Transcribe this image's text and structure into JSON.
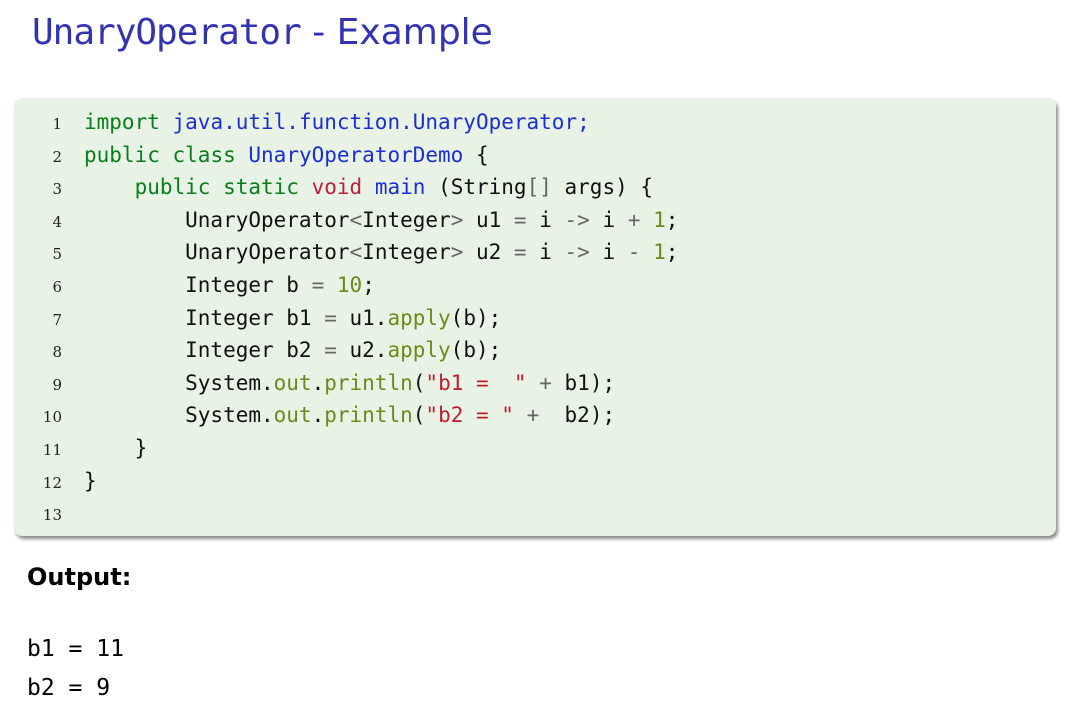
{
  "title": {
    "mono_part": "UnaryOperator",
    "sans_part": " - Example"
  },
  "code_lines": [
    {
      "no": "1",
      "text": "import java.util.function.UnaryOperator;"
    },
    {
      "no": "2",
      "text": "public class UnaryOperatorDemo {"
    },
    {
      "no": "3",
      "text": "    public static void main (String[] args) {"
    },
    {
      "no": "4",
      "text": "        UnaryOperator<Integer> u1 = i -> i + 1;"
    },
    {
      "no": "5",
      "text": "        UnaryOperator<Integer> u2 = i -> i - 1;"
    },
    {
      "no": "6",
      "text": "        Integer b = 10;"
    },
    {
      "no": "7",
      "text": "        Integer b1 = u1.apply(b);"
    },
    {
      "no": "8",
      "text": "        Integer b2 = u2.apply(b);"
    },
    {
      "no": "9",
      "text": "        System.out.println(\"b1 =  \" + b1);"
    },
    {
      "no": "10",
      "text": "        System.out.println(\"b2 = \" +  b2);"
    },
    {
      "no": "11",
      "text": "    }"
    },
    {
      "no": "12",
      "text": "}"
    },
    {
      "no": "13",
      "text": ""
    }
  ],
  "output": {
    "label": "Output:",
    "lines": [
      "b1 = 11",
      "b2 = 9"
    ]
  },
  "colors": {
    "title": "#3333b2",
    "code_background": "#e8f2e5",
    "keyword": "#0a7d1c",
    "class_name": "#1b2ecf",
    "type": "#b8233a",
    "string": "#c41a2a",
    "method": "#6c8a1a"
  }
}
